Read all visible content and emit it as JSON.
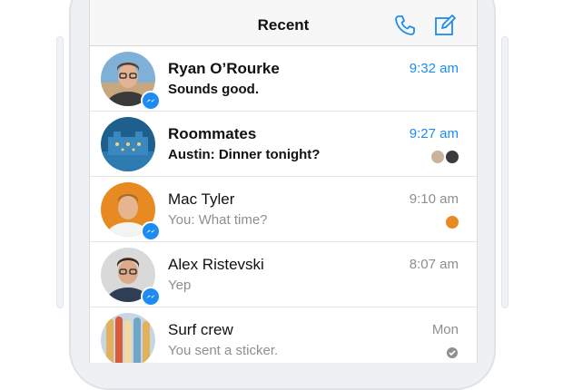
{
  "nav": {
    "title": "Recent",
    "icons": [
      "phone-icon",
      "compose-icon"
    ],
    "accent_color": "#1d8cf2"
  },
  "conversations": [
    {
      "name": "Ryan O’Rourke",
      "preview": "Sounds good.",
      "time": "9:32 am",
      "unread": true,
      "messenger_badge": true
    },
    {
      "name": "Roommates",
      "preview": "Austin: Dinner tonight?",
      "time": "9:27 am",
      "unread": true,
      "messenger_badge": false
    },
    {
      "name": "Mac Tyler",
      "preview": "You: What time?",
      "time": "9:10 am",
      "unread": false,
      "messenger_badge": true
    },
    {
      "name": "Alex Ristevski",
      "preview": "Yep",
      "time": "8:07 am",
      "unread": false,
      "messenger_badge": true
    },
    {
      "name": "Surf crew",
      "preview": "You sent a sticker.",
      "time": "Mon",
      "unread": false,
      "messenger_badge": false
    }
  ]
}
